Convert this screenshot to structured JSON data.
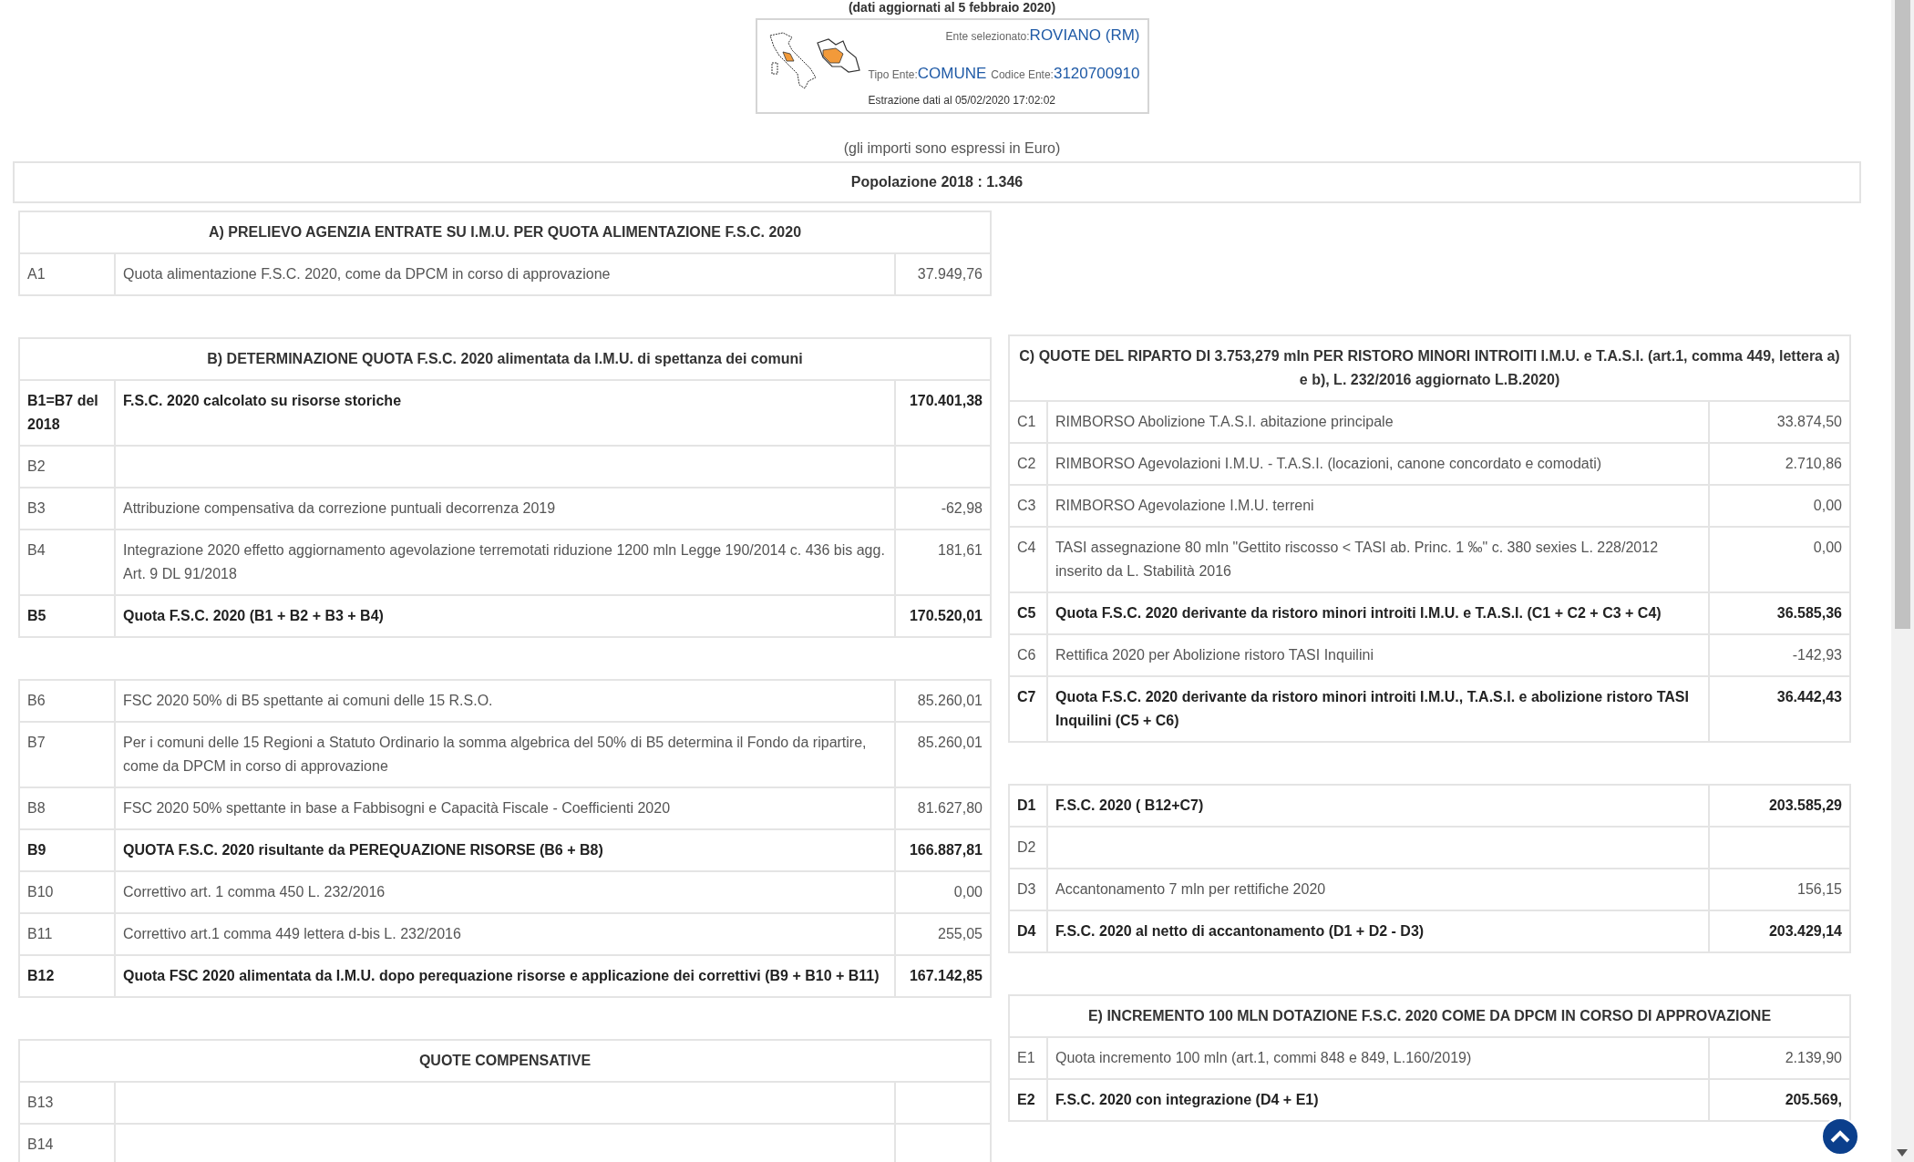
{
  "title": "(dati aggiornati al 5 febbraio 2020)",
  "ente": {
    "selected_label": "Ente selezionato:",
    "selected_value": "ROVIANO (RM)",
    "type_label": "Tipo Ente:",
    "type_value": "COMUNE",
    "code_label": "Codice Ente:",
    "code_value": "3120700910",
    "extraction": "Estrazione dati al 05/02/2020 17:02:02"
  },
  "currency_note": "(gli importi sono espressi in Euro)",
  "population": "Popolazione 2018 : 1.346",
  "left_tables": [
    {
      "title": "A) PRELIEVO AGENZIA ENTRATE SU I.M.U. PER QUOTA ALIMENTAZIONE F.S.C. 2020",
      "rows": [
        {
          "code": "A1",
          "text": "Quota alimentazione F.S.C. 2020, come da DPCM in corso di approvazione",
          "value": "37.949,76",
          "bold": false
        }
      ]
    },
    {
      "title": "B) DETERMINAZIONE QUOTA F.S.C. 2020 alimentata da I.M.U. di spettanza dei comuni",
      "rows": [
        {
          "code": "B1=B7 del 2018",
          "text": "F.S.C. 2020 calcolato su risorse storiche",
          "value": "170.401,38",
          "bold": true
        },
        {
          "code": "B2",
          "bold": false
        },
        {
          "code": "B3",
          "text": "Attribuzione compensativa da correzione puntuali decorrenza 2019",
          "value": "-62,98",
          "bold": false
        },
        {
          "code": "B4",
          "text": "Integrazione 2020 effetto aggiornamento agevolazione terremotati riduzione 1200 mln Legge 190/2014 c. 436 bis agg. Art. 9 DL 91/2018",
          "value": "181,61",
          "bold": false
        },
        {
          "code": "B5",
          "text": "Quota F.S.C. 2020 (B1 + B2 + B3 + B4)",
          "value": "170.520,01",
          "bold": true
        }
      ]
    },
    {
      "rows": [
        {
          "code": "B6",
          "text": "FSC 2020 50% di B5 spettante ai comuni delle 15 R.S.O.",
          "value": "85.260,01",
          "bold": false
        },
        {
          "code": "B7",
          "text": "Per i comuni delle 15 Regioni a Statuto Ordinario la somma algebrica del 50% di B5 determina il Fondo da ripartire, come da DPCM in corso di approvazione",
          "value": "85.260,01",
          "bold": false
        },
        {
          "code": "B8",
          "text": "FSC 2020 50% spettante in base a Fabbisogni e Capacità Fiscale - Coefficienti 2020",
          "value": "81.627,80",
          "bold": false
        },
        {
          "code": "B9",
          "text": "QUOTA F.S.C. 2020 risultante da PEREQUAZIONE RISORSE (B6 + B8)",
          "value": "166.887,81",
          "bold": true
        },
        {
          "code": "B10",
          "text": "Correttivo art. 1 comma 450 L. 232/2016",
          "value": "0,00",
          "bold": false
        },
        {
          "code": "B11",
          "text": "Correttivo art.1 comma 449 lettera d-bis L. 232/2016",
          "value": "255,05",
          "bold": false
        },
        {
          "code": "B12",
          "text": "Quota FSC 2020 alimentata da I.M.U. dopo perequazione risorse e applicazione dei correttivi (B9 + B10 + B11)",
          "value": "167.142,85",
          "bold": true
        }
      ]
    },
    {
      "title": "QUOTE COMPENSATIVE",
      "rows": [
        {
          "code": "B13",
          "bold": false
        },
        {
          "code": "B14",
          "bold": false
        }
      ]
    }
  ],
  "right_tables": [
    {
      "title": "C) QUOTE DEL RIPARTO DI 3.753,279 mln PER RISTORO MINORI INTROITI I.M.U. e T.A.S.I. (art.1, comma 449, lettera a) e b), L. 232/2016 aggiornato L.B.2020)",
      "rows": [
        {
          "code": "C1",
          "text": "RIMBORSO Abolizione T.A.S.I. abitazione principale",
          "value": "33.874,50",
          "bold": false
        },
        {
          "code": "C2",
          "text": "RIMBORSO Agevolazioni I.M.U. - T.A.S.I. (locazioni, canone concordato e comodati)",
          "value": "2.710,86",
          "bold": false
        },
        {
          "code": "C3",
          "text": "RIMBORSO Agevolazione I.M.U. terreni",
          "value": "0,00",
          "bold": false
        },
        {
          "code": "C4",
          "text": "TASI assegnazione 80 mln \"Gettito riscosso < TASI ab. Princ. 1 ‰\" c. 380 sexies L. 228/2012 inserito da L. Stabilità 2016",
          "value": "0,00",
          "bold": false
        },
        {
          "code": "C5",
          "text": "Quota F.S.C. 2020 derivante da ristoro minori introiti I.M.U. e T.A.S.I. (C1 + C2 + C3 + C4)",
          "value": "36.585,36",
          "bold": true
        },
        {
          "code": "C6",
          "text": "Rettifica 2020 per Abolizione ristoro TASI Inquilini",
          "value": "-142,93",
          "bold": false
        },
        {
          "code": "C7",
          "text": "Quota F.S.C. 2020 derivante da ristoro minori introiti I.M.U., T.A.S.I. e abolizione ristoro TASI Inquilini (C5 + C6)",
          "value": "36.442,43",
          "bold": true
        }
      ]
    },
    {
      "rows": [
        {
          "code": "D1",
          "text": "F.S.C. 2020 ( B12+C7)",
          "value": "203.585,29",
          "bold": true
        },
        {
          "code": "D2",
          "bold": false
        },
        {
          "code": "D3",
          "text": "Accantonamento 7 mln per rettifiche 2020",
          "value": "156,15",
          "bold": false
        },
        {
          "code": "D4",
          "text": "F.S.C. 2020 al netto di accantonamento (D1 + D2 - D3)",
          "value": "203.429,14",
          "bold": true
        }
      ]
    },
    {
      "title": "E) INCREMENTO 100 MLN DOTAZIONE F.S.C. 2020 COME DA DPCM IN CORSO DI APPROVAZIONE",
      "rows": [
        {
          "code": "E1",
          "text": "Quota incremento 100 mln (art.1, commi 848 e 849, L.160/2019)",
          "value": "2.139,90",
          "bold": false
        },
        {
          "code": "E2",
          "text": "F.S.C. 2020 con integrazione (D4 + E1)",
          "value": "205.569,",
          "bold": true
        }
      ]
    }
  ]
}
